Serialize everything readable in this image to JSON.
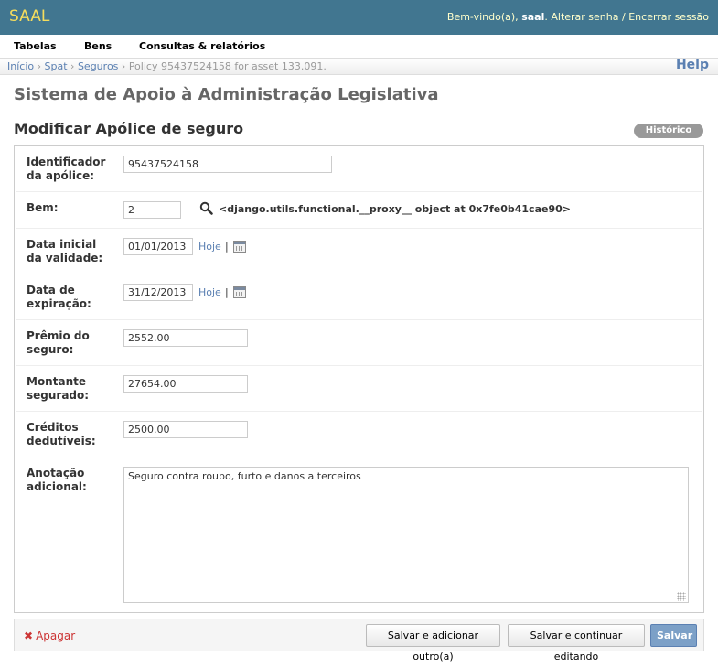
{
  "header": {
    "brand": "SAAL",
    "welcome": "Bem-vindo(a),",
    "username": "saal",
    "change_password": "Alterar senha",
    "separator": "/",
    "logout": "Encerrar sessão"
  },
  "menu": [
    "Tabelas",
    "Bens",
    "Consultas & relatórios"
  ],
  "breadcrumbs": {
    "home": "Início",
    "app": "Spat",
    "model": "Seguros",
    "current": "Policy 95437524158 for asset 133.091."
  },
  "help_label": "Help",
  "site_title": "Sistema de Apoio à Administração Legislativa",
  "page_title": "Modificar Apólice de seguro",
  "history_label": "Histórico",
  "form": {
    "policy_id": {
      "label_1": "Identificador",
      "label_2": "da apólice:",
      "value": "95437524158"
    },
    "asset": {
      "label": "Bem:",
      "value": "2",
      "lookup_text": "<django.utils.functional.__proxy__ object at 0x7fe0b41cae90>"
    },
    "start_date": {
      "label_1": "Data inicial",
      "label_2": "da validade:",
      "value": "01/01/2013"
    },
    "expiry_date": {
      "label_1": "Data de",
      "label_2": "expiração:",
      "value": "31/12/2013"
    },
    "premium": {
      "label_1": "Prêmio do",
      "label_2": "seguro:",
      "value": "2552.00"
    },
    "insured_amount": {
      "label_1": "Montante",
      "label_2": "segurado:",
      "value": "27654.00"
    },
    "deductible": {
      "label_1": "Créditos",
      "label_2": "dedutíveis:",
      "value": "2500.00"
    },
    "notes": {
      "label_1": "Anotação",
      "label_2": "adicional:",
      "value": "Seguro contra roubo, furto e danos a terceiros"
    },
    "today_label": "Hoje",
    "pipe": "|"
  },
  "actions": {
    "delete_icon": "✖",
    "delete_label": "Apagar",
    "save_add_another": "Salvar e adicionar outro(a)",
    "save_continue": "Salvar e continuar editando",
    "save": "Salvar"
  },
  "colors": {
    "header_bg": "#417690",
    "brand": "#f5dd5d",
    "link": "#5b80b2",
    "delete": "#cc3434",
    "save_button": "#7ca0c7"
  },
  "icons": {
    "lookup": "magnifier-icon",
    "calendar": "calendar-icon",
    "delete": "delete-x-icon",
    "resize": "resize-grip-icon"
  }
}
